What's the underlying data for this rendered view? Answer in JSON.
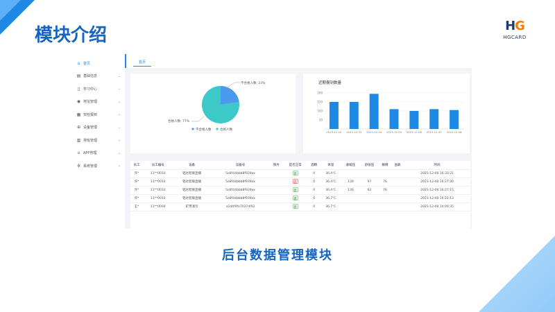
{
  "slide": {
    "title": "模块介绍",
    "caption": "后台数据管理模块",
    "logo_text": "HGCARD"
  },
  "colors": {
    "accent": "#1e88e5",
    "pie_a": "#4a9bf0",
    "pie_b": "#3ec9c9",
    "bar": "#1e88e5"
  },
  "sidebar": {
    "items": [
      {
        "label": "首页",
        "icon": "home-icon",
        "active": true,
        "chevron": false
      },
      {
        "label": "基础信息",
        "icon": "document-icon",
        "chevron": true
      },
      {
        "label": "学习中心",
        "icon": "book-icon",
        "chevron": true
      },
      {
        "label": "地址管理",
        "icon": "location-icon",
        "chevron": true
      },
      {
        "label": "安检报到",
        "icon": "calendar-icon",
        "chevron": true
      },
      {
        "label": "设备管理",
        "icon": "device-icon",
        "chevron": true
      },
      {
        "label": "排班管理",
        "icon": "schedule-icon",
        "chevron": true
      },
      {
        "label": "APP管理",
        "icon": "app-icon",
        "chevron": true
      },
      {
        "label": "系统管理",
        "icon": "gear-icon",
        "chevron": true
      }
    ]
  },
  "tabs": {
    "home": "首页"
  },
  "chart_data": [
    {
      "type": "pie",
      "labels": [
        "不合格人数",
        "合格人数"
      ],
      "values": [
        23,
        77
      ],
      "slice_labels": [
        "不合格人数: 23%",
        "合格人数: 77%"
      ],
      "legend": [
        "不合格人数",
        "合格人数"
      ],
      "legend_placement": "bottom"
    },
    {
      "type": "bar",
      "title": "近期报到数量",
      "categories": [
        "2023-12-02",
        "2023-12-03",
        "2023-12-04",
        "2023-12-05",
        "2023-12-06",
        "2023-12-07",
        "2023-12-08"
      ],
      "values": [
        150,
        150,
        195,
        110,
        100,
        110,
        105
      ],
      "yticks": [
        "200",
        "150",
        "100",
        "50"
      ],
      "ylim": [
        0,
        200
      ],
      "grid": true
    }
  ],
  "table": {
    "headers": [
      "员工",
      "员工编号",
      "设备",
      "设备号",
      "照片",
      "是否正常",
      "酒精",
      "体温",
      "收缩压",
      "舒张压",
      "脉搏",
      "血氧",
      "时间"
    ],
    "rows": [
      {
        "cells": [
          "许*",
          "11**0010",
          "铝达智联直播",
          "5e8f44bbb8f939ax",
          "",
          "",
          "0",
          "36.4℃",
          "",
          "",
          "",
          "",
          "2023-12-08 16:33:21"
        ],
        "status": "ok",
        "status_label": "是"
      },
      {
        "cells": [
          "许*",
          "11**0010",
          "铝达智联直播",
          "5e8f44bbb8f939ax",
          "",
          "",
          "0",
          "36.4℃",
          "139",
          "97",
          "76",
          "",
          "2023-12-08 16:27:30"
        ],
        "status": "bad",
        "status_label": "否"
      },
      {
        "cells": [
          "许*",
          "11**0010",
          "铝达智联直播",
          "5e8f44bbb8f939ax",
          "",
          "",
          "0",
          "36.4℃",
          "136",
          "62",
          "76",
          "",
          "2023-12-08 16:27:15"
        ],
        "status": "ok",
        "status_label": "是"
      },
      {
        "cells": [
          "许*",
          "11**0010",
          "铝达智联直播",
          "5e8f44bbb8f939ax",
          "",
          "",
          "0",
          "36.7℃",
          "",
          "",
          "",
          "",
          "2023-12-08 16:22:13"
        ],
        "status": "ok",
        "status_label": "是"
      },
      {
        "cells": [
          "王*",
          "11**0009",
          "矿用演示",
          "a1d4f9fa7027df92",
          "",
          "",
          "0",
          "36.7℃",
          "",
          "",
          "",
          "",
          "2023-12-08 14:09:35"
        ],
        "status": "ok",
        "status_label": "是"
      }
    ]
  }
}
